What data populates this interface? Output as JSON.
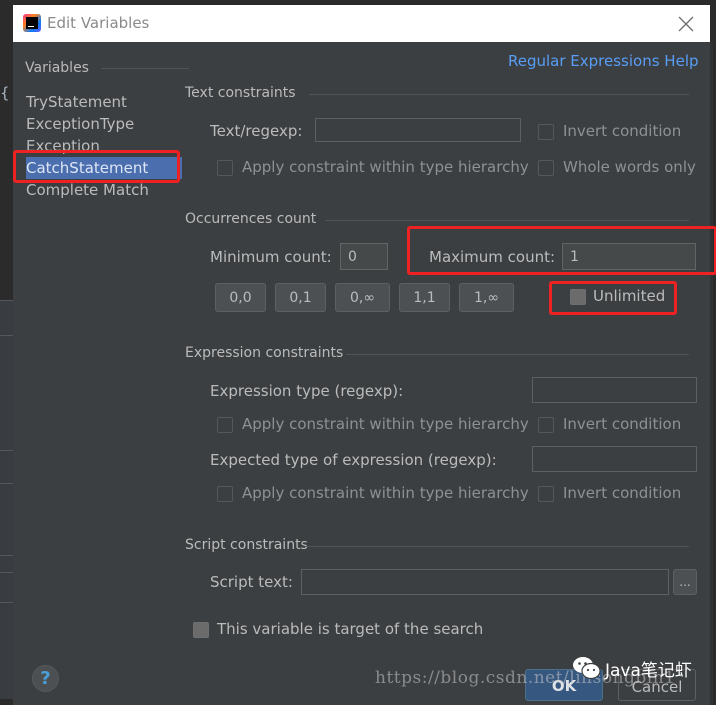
{
  "window": {
    "title": "Edit Variables",
    "close_icon": "close-icon",
    "app_icon": "intellij-idea-icon"
  },
  "help_link": "Regular Expressions Help",
  "variables": {
    "header": "Variables",
    "items": [
      {
        "label": "TryStatement",
        "selected": false
      },
      {
        "label": "ExceptionType",
        "selected": false
      },
      {
        "label": "Exception",
        "selected": false
      },
      {
        "label": "CatchStatement",
        "selected": true
      },
      {
        "label": "Complete Match",
        "selected": false
      }
    ]
  },
  "text_constraints": {
    "title": "Text constraints",
    "text_regexp_label": "Text/regexp:",
    "text_regexp_value": "",
    "invert_condition": {
      "label": "Invert condition",
      "checked": false
    },
    "apply_within_hierarchy": {
      "label": "Apply constraint within type hierarchy",
      "checked": false
    },
    "whole_words_only": {
      "label": "Whole words only",
      "checked": false
    }
  },
  "occurrences": {
    "title": "Occurrences count",
    "min_label": "Minimum count:",
    "min_value": "0",
    "max_label": "Maximum count:",
    "max_value": "1",
    "presets": [
      "0,0",
      "0,1",
      "0,∞",
      "1,1",
      "1,∞"
    ],
    "unlimited": {
      "label": "Unlimited",
      "checked": false
    }
  },
  "expression_constraints": {
    "title": "Expression constraints",
    "expression_type_label": "Expression type (regexp):",
    "expression_type_value": "",
    "apply_within_hierarchy_1": {
      "label": "Apply constraint within type hierarchy",
      "checked": false
    },
    "invert_condition_1": {
      "label": "Invert condition",
      "checked": false
    },
    "expected_type_label": "Expected type of expression (regexp):",
    "expected_type_value": "",
    "apply_within_hierarchy_2": {
      "label": "Apply constraint within type hierarchy",
      "checked": false
    },
    "invert_condition_2": {
      "label": "Invert condition",
      "checked": false
    }
  },
  "script_constraints": {
    "title": "Script constraints",
    "script_text_label": "Script text:",
    "script_text_value": "",
    "browse_label": "..."
  },
  "target_checkbox": {
    "label": "This variable is target of the search",
    "checked": false
  },
  "footer": {
    "help_label": "?",
    "ok_label": "OK",
    "cancel_label": "Cancel"
  },
  "watermark": {
    "url": "https://blog.csdn.net/linsongbin1",
    "brand": "Java笔记虾"
  },
  "colors": {
    "dialog_bg": "#3c3f41",
    "selection": "#4b6eaf",
    "link": "#589df6",
    "highlight_box": "#ee2222",
    "ok_button": "#365880"
  }
}
